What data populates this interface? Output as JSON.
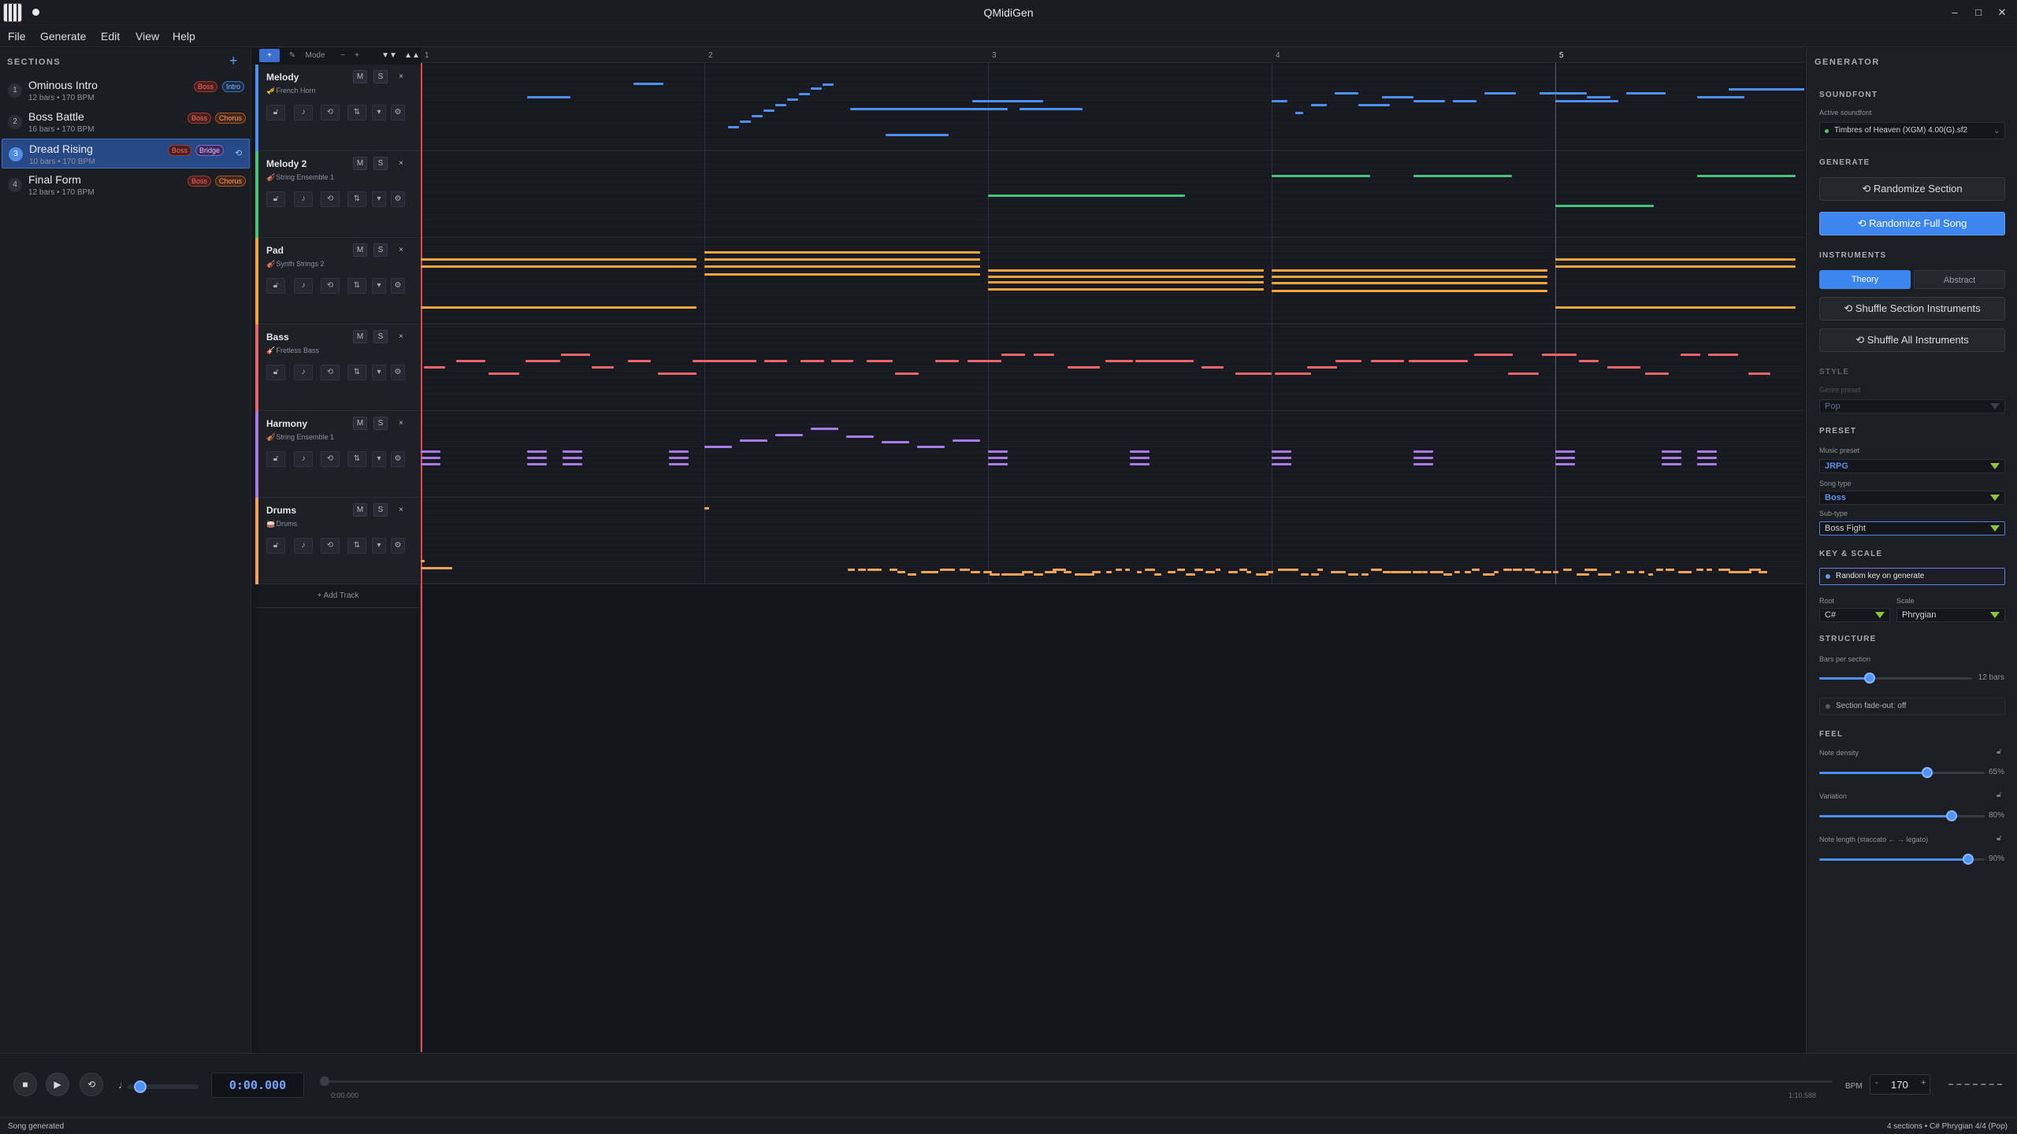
{
  "window": {
    "title": "QMidiGen",
    "min": "–",
    "max": "□",
    "close": "✕"
  },
  "menu": [
    "File",
    "Generate",
    "Edit",
    "View",
    "Help"
  ],
  "sections_panel": {
    "title": "SECTIONS",
    "add": "+",
    "items": [
      {
        "num": "1",
        "name": "Ominous Intro",
        "meta": "12 bars • 170 BPM",
        "tags": [
          "Boss",
          "Intro"
        ]
      },
      {
        "num": "2",
        "name": "Boss Battle",
        "meta": "16 bars • 170 BPM",
        "tags": [
          "Boss",
          "Chorus"
        ]
      },
      {
        "num": "3",
        "name": "Dread Rising",
        "meta": "10 bars • 170 BPM",
        "tags": [
          "Boss",
          "Bridge"
        ]
      },
      {
        "num": "4",
        "name": "Final Form",
        "meta": "12 bars • 170 BPM",
        "tags": [
          "Boss",
          "Chorus"
        ]
      }
    ]
  },
  "toolbar": {
    "select": "+",
    "draw": "✎",
    "mode_label": "Mode",
    "zoom_out": "−",
    "zoom_in": "+",
    "collapse": "▼▼",
    "expand": "▲▲"
  },
  "ruler": [
    "1",
    "2",
    "3",
    "4",
    "5"
  ],
  "tracks": [
    {
      "name": "Melody",
      "instrument": "French Horn",
      "color": "#4f8ff0"
    },
    {
      "name": "Melody 2",
      "instrument": "String Ensemble 1",
      "color": "#45c47c"
    },
    {
      "name": "Pad",
      "instrument": "Synth Strings 2",
      "color": "#f0a63a"
    },
    {
      "name": "Bass",
      "instrument": "Fretless Bass",
      "color": "#e8666a"
    },
    {
      "name": "Harmony",
      "instrument": "String Ensemble 1",
      "color": "#a77be8"
    },
    {
      "name": "Drums",
      "instrument": "Drums",
      "color": "#f1a35a"
    }
  ],
  "track_buttons": {
    "mute": "M",
    "solo": "S",
    "remove": "×"
  },
  "add_track": "+ Add Track",
  "generator": {
    "title": "GENERATOR",
    "soundfont": {
      "label": "SOUNDFONT",
      "sub": "Active soundfont",
      "value": "Timbres of Heaven (XGM) 4.00(G).sf2"
    },
    "generate": {
      "label": "GENERATE",
      "randomize_section": "⟲  Randomize Section",
      "randomize_song": "⟲  Randomize Full Song"
    },
    "instruments": {
      "label": "INSTRUMENTS",
      "theory": "Theory",
      "abstract": "Abstract",
      "shuffle_section": "⟲  Shuffle Section Instruments",
      "shuffle_all": "⟲  Shuffle All Instruments"
    },
    "style": {
      "label": "STYLE",
      "sub": "Genre preset",
      "value": "Pop"
    },
    "preset": {
      "label": "PRESET",
      "music_preset_label": "Music preset",
      "music_preset": "JRPG",
      "song_type_label": "Song type",
      "song_type": "Boss",
      "sub_type_label": "Sub-type",
      "sub_type": "Boss Fight"
    },
    "key_scale": {
      "label": "KEY & SCALE",
      "random_key": "Random key on generate",
      "root_label": "Root",
      "root": "C#",
      "scale_label": "Scale",
      "scale": "Phrygian"
    },
    "structure": {
      "label": "STRUCTURE",
      "bars_label": "Bars per section",
      "bars_value": "12 bars",
      "bars_fraction": 0.33,
      "fade_out": "Section fade-out: off"
    },
    "feel": {
      "label": "FEEL",
      "density_label": "Note density",
      "density_value": "65%",
      "density": 0.65,
      "variation_label": "Variation",
      "variation_value": "80%",
      "variation": 0.8,
      "length_label": "Note length  (staccato ← → legato)",
      "length_value": "90%",
      "length": 0.9
    }
  },
  "transport": {
    "stop": "■",
    "play": "▶",
    "loop": "⟲",
    "metronome": "♩",
    "time": "0:00.000",
    "start_time": "0:00.000",
    "end_time": "1:10.588",
    "bpm_label": "BPM",
    "bpm_minus": "-",
    "bpm": "170",
    "bpm_plus": "+"
  },
  "status": {
    "left": "Song generated",
    "right": "4 sections  •  C# Phrygian 4/4 (Pop)"
  },
  "colors": {
    "accent": "#3d86f0",
    "playhead": "#e04a4a"
  }
}
